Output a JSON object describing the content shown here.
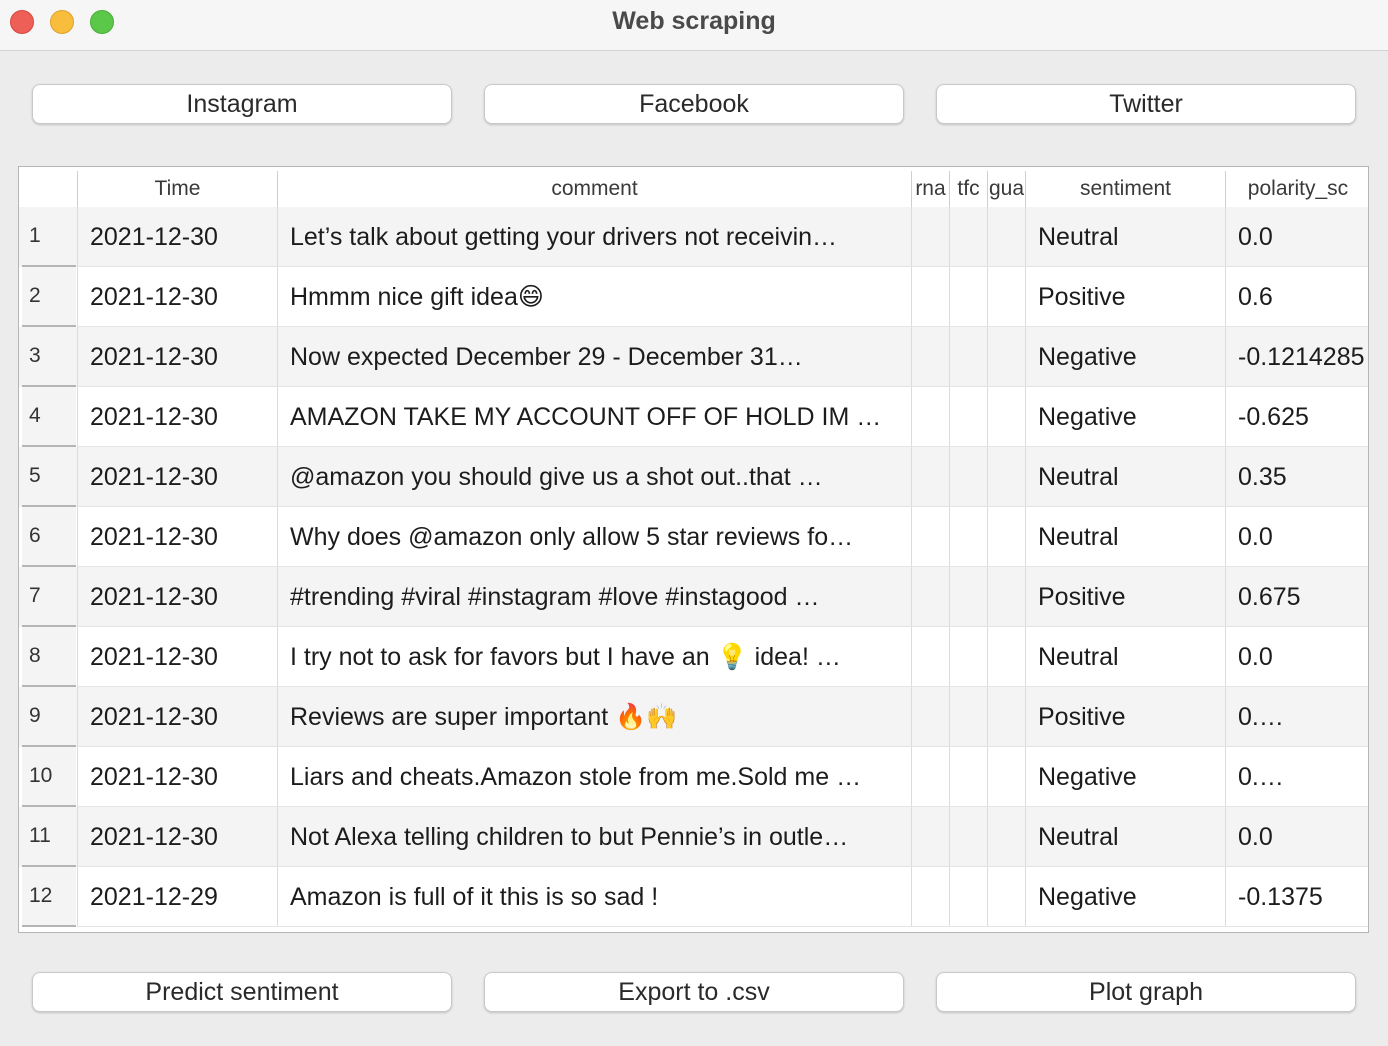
{
  "window": {
    "title": "Web scraping"
  },
  "top_buttons": [
    "Instagram",
    "Facebook",
    "Twitter"
  ],
  "bottom_buttons": [
    "Predict sentiment",
    "Export to .csv",
    "Plot graph"
  ],
  "table": {
    "columns": [
      "Time",
      "comment",
      "rna",
      "tfc",
      "gua",
      "sentiment",
      "polarity_sc"
    ],
    "rows": [
      {
        "num": "1",
        "time": "2021-12-30",
        "comment": "Let’s talk about getting your drivers not receivin…",
        "sentiment": "Neutral",
        "polarity": "0.0"
      },
      {
        "num": "2",
        "time": "2021-12-30",
        "comment": "Hmmm nice gift idea😄",
        "sentiment": "Positive",
        "polarity": "0.6"
      },
      {
        "num": "3",
        "time": "2021-12-30",
        "comment": "Now expected December 29 - December 31…",
        "sentiment": "Negative",
        "polarity": "-0.1214285"
      },
      {
        "num": "4",
        "time": "2021-12-30",
        "comment": "AMAZON TAKE MY ACCOUNT OFF OF HOLD IM …",
        "sentiment": "Negative",
        "polarity": "-0.625"
      },
      {
        "num": "5",
        "time": "2021-12-30",
        "comment": "@amazon you should give us a shot out..that …",
        "sentiment": "Neutral",
        "polarity": "0.35"
      },
      {
        "num": "6",
        "time": "2021-12-30",
        "comment": "Why does @amazon  only allow 5 star reviews fo…",
        "sentiment": "Neutral",
        "polarity": "0.0"
      },
      {
        "num": "7",
        "time": "2021-12-30",
        "comment": "#trending #viral #instagram #love #instagood …",
        "sentiment": "Positive",
        "polarity": "0.675"
      },
      {
        "num": "8",
        "time": "2021-12-30",
        "comment": "I try not to ask for favors but I have an 💡 idea! …",
        "sentiment": "Neutral",
        "polarity": "0.0"
      },
      {
        "num": "9",
        "time": "2021-12-30",
        "comment": "Reviews are super important 🔥🙌",
        "sentiment": "Positive",
        "polarity": "0.…"
      },
      {
        "num": "10",
        "time": "2021-12-30",
        "comment": "Liars and cheats.Amazon stole from me.Sold me …",
        "sentiment": "Negative",
        "polarity": "0.…"
      },
      {
        "num": "11",
        "time": "2021-12-30",
        "comment": "Not Alexa telling children to but Pennie’s in outle…",
        "sentiment": "Neutral",
        "polarity": "0.0"
      },
      {
        "num": "12",
        "time": "2021-12-29",
        "comment": "Amazon is full of it this is so sad !",
        "sentiment": "Negative",
        "polarity": "-0.1375"
      }
    ]
  }
}
